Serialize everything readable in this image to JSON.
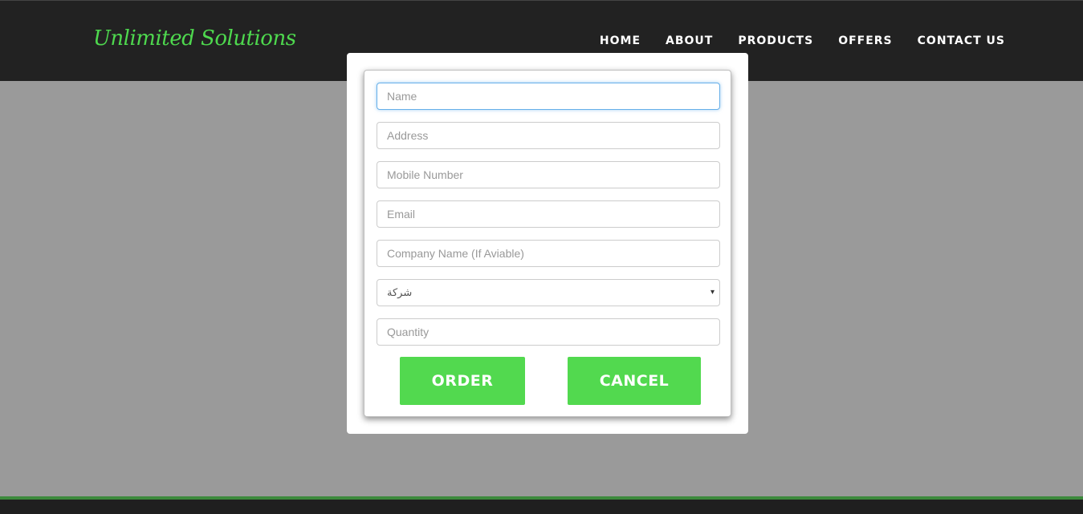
{
  "header": {
    "logo": "Unlimited Solutions",
    "nav": [
      "HOME",
      "ABOUT",
      "PRODUCTS",
      "OFFERS",
      "CONTACT US"
    ]
  },
  "form": {
    "name_placeholder": "Name",
    "address_placeholder": "Address",
    "mobile_placeholder": "Mobile Number",
    "email_placeholder": "Email",
    "company_placeholder": "Company Name (If Aviable)",
    "type_selected": "شركة",
    "quantity_placeholder": "Quantity",
    "order_label": "ORDER",
    "cancel_label": "CANCEL"
  },
  "colors": {
    "accent": "#52d94f",
    "header_bg": "#222222",
    "overlay": "#9a9a9a"
  }
}
